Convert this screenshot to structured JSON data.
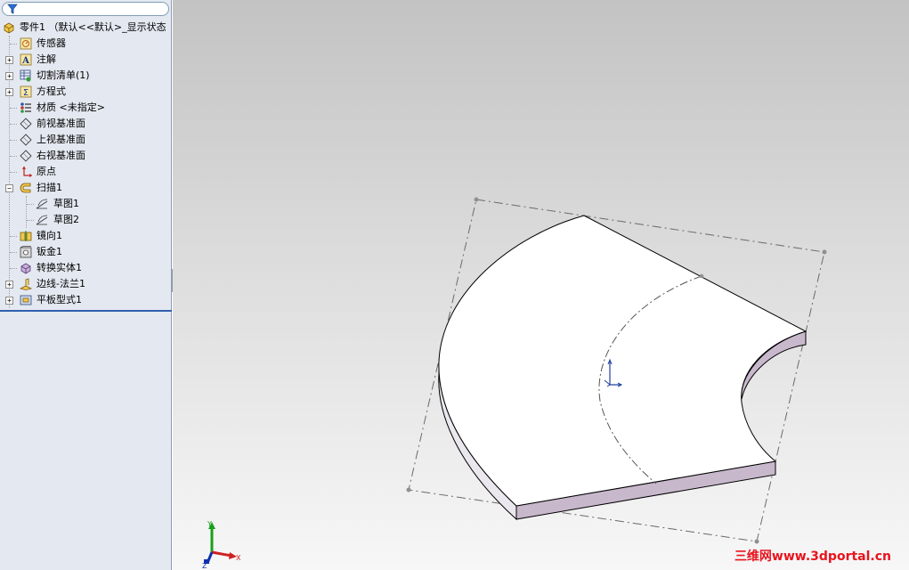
{
  "feature_tree": {
    "search_placeholder": "",
    "items": [
      {
        "label": "零件1 （默认<<默认>_显示状态",
        "icon": "part-icon",
        "expander": ""
      },
      {
        "label": "传感器",
        "icon": "sensor-icon",
        "expander": ""
      },
      {
        "label": "注解",
        "icon": "annotation-icon",
        "expander": "+"
      },
      {
        "label": "切割清单(1)",
        "icon": "cut-list-icon",
        "expander": "+"
      },
      {
        "label": "方程式",
        "icon": "equation-icon",
        "expander": "+"
      },
      {
        "label": "材质 <未指定>",
        "icon": "material-icon",
        "expander": ""
      },
      {
        "label": "前视基准面",
        "icon": "plane-icon",
        "expander": ""
      },
      {
        "label": "上视基准面",
        "icon": "plane-icon",
        "expander": ""
      },
      {
        "label": "右视基准面",
        "icon": "plane-icon",
        "expander": ""
      },
      {
        "label": "原点",
        "icon": "origin-icon",
        "expander": ""
      },
      {
        "label": "扫描1",
        "icon": "sweep-icon",
        "expander": "−"
      },
      {
        "label": "草图1",
        "icon": "sketch-icon",
        "expander": ""
      },
      {
        "label": "草图2",
        "icon": "sketch-icon",
        "expander": ""
      },
      {
        "label": "镜向1",
        "icon": "mirror-icon",
        "expander": ""
      },
      {
        "label": "钣金1",
        "icon": "sheet-metal-icon",
        "expander": ""
      },
      {
        "label": "转换实体1",
        "icon": "convert-entities-icon",
        "expander": ""
      },
      {
        "label": "边线-法兰1",
        "icon": "edge-flange-icon",
        "expander": "+"
      },
      {
        "label": "平板型式1",
        "icon": "flat-pattern-icon",
        "expander": "+"
      }
    ]
  },
  "triad": {
    "x_label": "X",
    "y_label": "Y",
    "z_label": "Z"
  },
  "watermark": "三维网www.3dportal.cn",
  "colors": {
    "panel_bg": "#e4e9f1",
    "edge": "#000000",
    "side_face": "#c8b8cc",
    "axis_blue": "#0a2a9a",
    "watermark": "#e8141e"
  }
}
